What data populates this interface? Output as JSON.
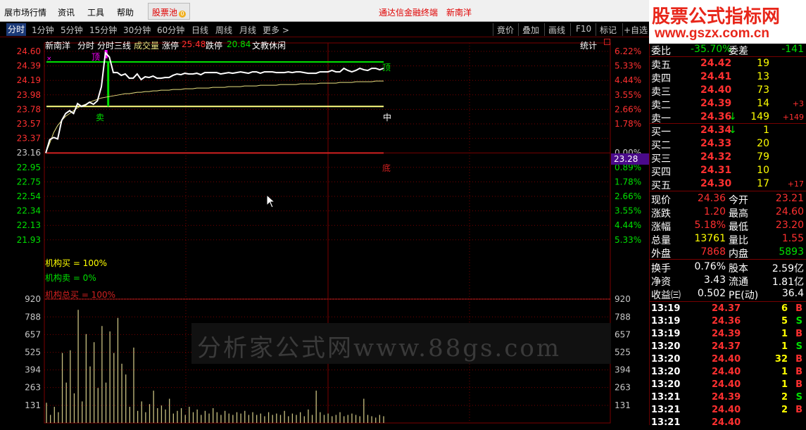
{
  "menubar": {
    "items": [
      "展市场行情",
      "资讯",
      "工具",
      "帮助"
    ],
    "pool": "股票池",
    "pool_badge": "⓪",
    "center_title": "通达信金融终端",
    "stock_name": "新南洋"
  },
  "logo": {
    "title": "股票公式指标网",
    "url": "www.gszx.com.cn"
  },
  "tabs": {
    "left": [
      "分时",
      "1分钟",
      "5分钟",
      "15分钟",
      "30分钟",
      "60分钟",
      "日线",
      "周线",
      "月线",
      "更多 >"
    ],
    "right": [
      "竟价",
      "叠加",
      "画线",
      "F10",
      "标记",
      "+自选"
    ],
    "active": "分时"
  },
  "chart_header": {
    "name": "新南洋",
    "items": [
      "分时",
      "分时三线",
      "成交量"
    ],
    "limit_up_label": "涨停",
    "limit_up": "25.48",
    "limit_down_label": "跌停",
    "limit_down": "20.84",
    "industry": "文教休闲",
    "stats": "统计"
  },
  "price_axis": [
    "24.60",
    "24.39",
    "24.19",
    "23.98",
    "23.78",
    "23.57",
    "23.37",
    "23.16",
    "22.95",
    "22.75",
    "22.54",
    "22.34",
    "22.13",
    "21.93"
  ],
  "pct_axis": [
    "6.22%",
    "5.33%",
    "4.44%",
    "3.55%",
    "2.66%",
    "1.78%",
    "",
    "0.00%",
    "0.89%",
    "1.78%",
    "2.66%",
    "3.55%",
    "4.44%",
    "5.33%"
  ],
  "current_price_tag": "23.28",
  "volume_axis": [
    "920",
    "788",
    "657",
    "525",
    "394",
    "263",
    "131"
  ],
  "annotations": {
    "top": "顶",
    "sell": "卖",
    "top_right": "顶",
    "mid": "中",
    "bottom": "底",
    "inst_buy": "机构买 = 100%",
    "inst_sell": "机构卖 = 0%",
    "inst_total": "机构总买 = 100%"
  },
  "watermark": "分析家公式网www.88gs.com",
  "chart_data": {
    "type": "line",
    "price_series": [
      23.16,
      23.35,
      23.38,
      23.36,
      23.62,
      23.72,
      23.76,
      23.72,
      23.86,
      23.82,
      23.84,
      23.88,
      23.85,
      23.9,
      24.1,
      24.58,
      24.52,
      24.3,
      24.3,
      24.26,
      24.28,
      24.22,
      24.22,
      24.28,
      24.2,
      24.24,
      24.23,
      24.25,
      24.22,
      24.22,
      24.23,
      24.23,
      24.26,
      24.28,
      24.27,
      24.29,
      24.28,
      24.28,
      24.29,
      24.27,
      24.3,
      24.3,
      24.3,
      24.3,
      24.28,
      24.29,
      24.3,
      24.29,
      24.3,
      24.31,
      24.3,
      24.29,
      24.31,
      24.31,
      24.29,
      24.31,
      24.31,
      24.31,
      24.3,
      24.3,
      24.3,
      24.31,
      24.3,
      24.31,
      24.31,
      24.3,
      24.29,
      24.29,
      24.29,
      24.31,
      24.31,
      24.31,
      24.33,
      24.31,
      24.31,
      24.36,
      24.33,
      24.31,
      24.33,
      24.36,
      24.34,
      24.33,
      24.36,
      24.36,
      24.34,
      24.36
    ],
    "avg_series": [
      23.16,
      23.3,
      23.45,
      23.55,
      23.62,
      23.68,
      23.72,
      23.76,
      23.8,
      23.83,
      23.85,
      23.88,
      23.9,
      23.92,
      23.94,
      23.95,
      23.96,
      23.97,
      23.98,
      23.99,
      24.0,
      24.0,
      24.01,
      24.02,
      24.02,
      24.03,
      24.03,
      24.04,
      24.04,
      24.05,
      24.05,
      24.05,
      24.06,
      24.06,
      24.06,
      24.07,
      24.07,
      24.07,
      24.08,
      24.08,
      24.08,
      24.08,
      24.09,
      24.09,
      24.09,
      24.09,
      24.1,
      24.1,
      24.1,
      24.1,
      24.11,
      24.11,
      24.11,
      24.11,
      24.12,
      24.12,
      24.12,
      24.12,
      24.12,
      24.13,
      24.13,
      24.13,
      24.13,
      24.13,
      24.14,
      24.14,
      24.14,
      24.14,
      24.14,
      24.15,
      24.15,
      24.15,
      24.15,
      24.15,
      24.16,
      24.16,
      24.16,
      24.16,
      24.17,
      24.17,
      24.17,
      24.17,
      24.17,
      24.18,
      24.18,
      24.18
    ],
    "volume_series": [
      150,
      60,
      120,
      80,
      520,
      300,
      540,
      220,
      840,
      160,
      660,
      420,
      600,
      260,
      720,
      300,
      680,
      520,
      780,
      440,
      360,
      120,
      560,
      90,
      160,
      80,
      140,
      240,
      110,
      130,
      100,
      180,
      70,
      90,
      110,
      60,
      120,
      80,
      100,
      60,
      90,
      70,
      110,
      80,
      60,
      90,
      70,
      60,
      80,
      70,
      90,
      60,
      80,
      60,
      70,
      50,
      80,
      60,
      70,
      60,
      90,
      50,
      70,
      60,
      80,
      50,
      100,
      60,
      240,
      80,
      60,
      70,
      50,
      60,
      80,
      50,
      60,
      70,
      60,
      50,
      180,
      60,
      50,
      40,
      60,
      50
    ],
    "ylim_price": [
      21.93,
      24.6
    ],
    "ylim_volume": [
      0,
      920
    ],
    "top_line": 24.45,
    "mid_line": 23.82,
    "bottom_line": 23.16
  },
  "order_book": {
    "wei_bi_label": "委比",
    "wei_bi": "-35.70%",
    "wei_cha_label": "委差",
    "wei_cha": "-141",
    "sells": [
      {
        "label": "卖五",
        "price": "24.42",
        "vol": "19",
        "chg": ""
      },
      {
        "label": "卖四",
        "price": "24.41",
        "vol": "13",
        "chg": ""
      },
      {
        "label": "卖三",
        "price": "24.40",
        "vol": "73",
        "chg": ""
      },
      {
        "label": "卖二",
        "price": "24.39",
        "vol": "14",
        "chg": "+3"
      },
      {
        "label": "卖一",
        "price": "24.36",
        "vol": "149",
        "chg": "+149",
        "arrow": "↓"
      }
    ],
    "buys": [
      {
        "label": "买一",
        "price": "24.34",
        "vol": "1",
        "chg": "",
        "arrow": "↓"
      },
      {
        "label": "买二",
        "price": "24.33",
        "vol": "20",
        "chg": ""
      },
      {
        "label": "买三",
        "price": "24.32",
        "vol": "79",
        "chg": ""
      },
      {
        "label": "买四",
        "price": "24.31",
        "vol": "10",
        "chg": ""
      },
      {
        "label": "买五",
        "price": "24.30",
        "vol": "17",
        "chg": "+17"
      }
    ]
  },
  "quote": [
    {
      "l1": "现价",
      "v1": "24.36",
      "l2": "今开",
      "v2": "23.21"
    },
    {
      "l1": "涨跌",
      "v1": "1.20",
      "l2": "最高",
      "v2": "24.60"
    },
    {
      "l1": "涨幅",
      "v1": "5.18%",
      "l2": "最低",
      "v2": "23.20"
    },
    {
      "l1": "总量",
      "v1": "13761",
      "l2": "量比",
      "v2": "1.55"
    },
    {
      "l1": "外盘",
      "v1": "7868",
      "l2": "内盘",
      "v2": "5893"
    }
  ],
  "fundamentals": [
    {
      "l1": "换手",
      "v1": "0.76%",
      "l2": "股本",
      "v2": "2.59亿"
    },
    {
      "l1": "净资",
      "v1": "3.43",
      "l2": "流通",
      "v2": "1.81亿"
    },
    {
      "l1": "收益㈢",
      "v1": "0.502",
      "l2": "PE(动)",
      "v2": "36.4"
    }
  ],
  "ticks": [
    {
      "time": "13:19",
      "price": "24.37",
      "vol": "6",
      "side": "B"
    },
    {
      "time": "13:19",
      "price": "24.36",
      "vol": "5",
      "side": "S"
    },
    {
      "time": "13:19",
      "price": "24.39",
      "vol": "1",
      "side": "B"
    },
    {
      "time": "13:20",
      "price": "24.37",
      "vol": "1",
      "side": "S"
    },
    {
      "time": "13:20",
      "price": "24.40",
      "vol": "32",
      "side": "B"
    },
    {
      "time": "13:20",
      "price": "24.40",
      "vol": "1",
      "side": "B"
    },
    {
      "time": "13:20",
      "price": "24.40",
      "vol": "1",
      "side": "B"
    },
    {
      "time": "13:21",
      "price": "24.39",
      "vol": "2",
      "side": "S"
    },
    {
      "time": "13:21",
      "price": "24.40",
      "vol": "2",
      "side": "B"
    },
    {
      "time": "13:21",
      "price": "24.40",
      "vol": "",
      "side": ""
    }
  ],
  "colors": {
    "up": "#ff3030",
    "down": "#00e000",
    "grid": "#7a0000",
    "price_line": "#ffffff",
    "avg_line": "#e8e080",
    "top_line": "#00e000",
    "mid_line": "#ffff80",
    "bottom_line": "#d02020",
    "volume": "#c8c080",
    "label_yellow": "#ffff00",
    "magenta": "#ff00ff"
  }
}
